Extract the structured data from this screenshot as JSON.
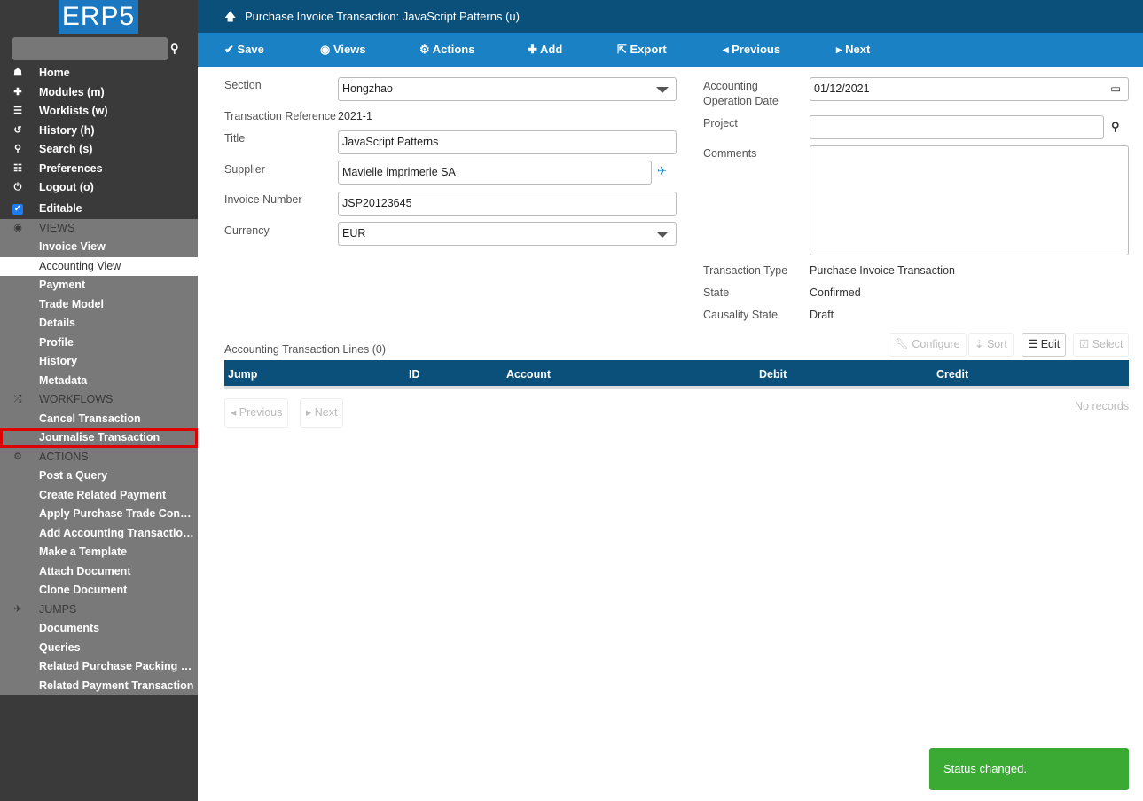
{
  "sidebar": {
    "logo": "ERP5",
    "search_placeholder": "",
    "nav": [
      {
        "label": "Home",
        "icon": "home-icon",
        "g": "☗"
      },
      {
        "label": "Modules (m)",
        "icon": "puzzle-icon",
        "g": "✚"
      },
      {
        "label": "Worklists (w)",
        "icon": "tasks-icon",
        "g": "☰"
      },
      {
        "label": "History (h)",
        "icon": "history-icon",
        "g": "↺"
      },
      {
        "label": "Search (s)",
        "icon": "search-icon",
        "g": "⚲"
      },
      {
        "label": "Preferences",
        "icon": "sliders-icon",
        "g": "☷"
      },
      {
        "label": "Logout (o)",
        "icon": "power-icon",
        "g": "⏻"
      }
    ],
    "editable": "Editable",
    "views_header": "VIEWS",
    "views": [
      "Invoice View",
      "Accounting View",
      "Payment",
      "Trade Model",
      "Details",
      "Profile",
      "History",
      "Metadata"
    ],
    "workflows_header": "WORKFLOWS",
    "workflows": [
      "Cancel Transaction",
      "Journalise Transaction"
    ],
    "actions_header": "ACTIONS",
    "actions": [
      "Post a Query",
      "Create Related Payment",
      "Apply Purchase Trade Conditi...",
      "Add Accounting Transaction L...",
      "Make a Template",
      "Attach Document",
      "Clone Document"
    ],
    "jumps_header": "JUMPS",
    "jumps": [
      "Documents",
      "Queries",
      "Related Purchase Packing List",
      "Related Payment Transaction"
    ]
  },
  "header": {
    "title": "Purchase Invoice Transaction: JavaScript Patterns (u)"
  },
  "toolbar": {
    "save": "Save",
    "views": "Views",
    "actions": "Actions",
    "add": "Add",
    "export": "Export",
    "previous": "Previous",
    "next": "Next"
  },
  "form": {
    "section_label": "Section",
    "section": "Hongzhao",
    "ref_label": "Transaction Reference",
    "ref": "2021-1",
    "title_label": "Title",
    "title": "JavaScript Patterns",
    "supplier_label": "Supplier",
    "supplier": "Mavielle imprimerie SA",
    "invoice_label": "Invoice Number",
    "invoice": "JSP20123645",
    "currency_label": "Currency",
    "currency": "EUR",
    "date_label": "Accounting Operation Date",
    "date": "01/12/2021",
    "project_label": "Project",
    "project": "",
    "comments_label": "Comments",
    "comments": "",
    "type_label": "Transaction Type",
    "type": "Purchase Invoice Transaction",
    "state_label": "State",
    "state": "Confirmed",
    "causality_label": "Causality State",
    "causality": "Draft"
  },
  "listbox": {
    "title": "Accounting Transaction Lines (0)",
    "configure": "Configure",
    "sort": "Sort",
    "edit": "Edit",
    "select": "Select",
    "columns": [
      "Jump",
      "ID",
      "Account",
      "Debit",
      "Credit"
    ],
    "previous": "Previous",
    "next": "Next",
    "empty": "No records"
  },
  "toast": "Status changed."
}
